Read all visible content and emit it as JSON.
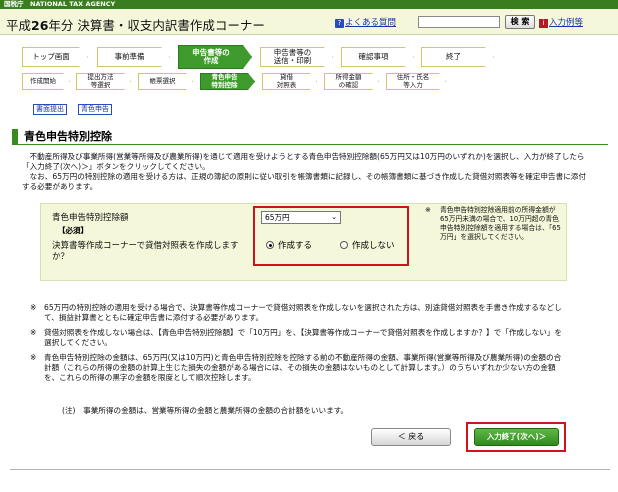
{
  "agency": "国税庁　NATIONAL TAX AGENCY",
  "header": {
    "title_prefix": "平成",
    "title_year": "26",
    "title_suffix": "年分 決算書・収支内訳書作成コーナー",
    "faq_icon": "?",
    "faq_link": "よくある質問",
    "search_placeholder": "",
    "search_button": "検 索",
    "help_icon": "i",
    "help_link": "入力例等"
  },
  "steps": [
    {
      "label": "トップ画面",
      "active": false
    },
    {
      "label": "事前準備",
      "active": false
    },
    {
      "label": "申告書等の\n作成",
      "active": true
    },
    {
      "label": "申告書等の\n送信・印刷",
      "active": false
    },
    {
      "label": "確認事項",
      "active": false
    },
    {
      "label": "終了",
      "active": false
    }
  ],
  "substeps": [
    {
      "label": "作成開始",
      "active": false
    },
    {
      "label": "提出方法\n等選択",
      "active": false
    },
    {
      "label": "帳票選択",
      "active": false
    },
    {
      "label": "青色申告\n特別控除",
      "active": true
    },
    {
      "label": "貸借\n対照表",
      "active": false
    },
    {
      "label": "所得金額\nの確認",
      "active": false
    },
    {
      "label": "住所・氏名\n等入力",
      "active": false
    }
  ],
  "tabs": {
    "first": "書面提出",
    "second": "青色申告"
  },
  "section_title": "青色申告特別控除",
  "intro": {
    "p1": "　不動産所得及び事業所得(営業等所得及び農業所得)を通じて適用を受けようとする青色申告特別控除額(65万円又は10万円のいずれか)を選択し、入力が終了したら「入力終了(次へ)＞」ボタンをクリックしてください。",
    "p2": "　なお、65万円の特別控除の適用を受ける方は、正規の簿記の原則に従い取引を帳簿書類に記録し、その帳簿書類に基づき作成した貸借対照表等を確定申告書に添付する必要があります。"
  },
  "form": {
    "deduction_label": "青色申告特別控除額",
    "required": "【必須】",
    "deduction_value": "65万円",
    "bs_question": "決算書等作成コーナーで貸借対照表を作成しますか？",
    "radio_yes": "作成する",
    "radio_no": "作成しない",
    "radio_selected": "yes",
    "note_mark": "※",
    "note": "青色申告特別控除適用前の所得金額が65万円未満の場合で、10万円超の青色申告特別控除額を適用する場合は、「65万円」を選択してください。"
  },
  "footnotes": [
    {
      "mark": "※",
      "text": "65万円の特別控除の適用を受ける場合で、決算書等作成コーナーで貸借対照表を作成しないを選択された方は、別途貸借対照表を手書き作成するなどして、損益計算書とともに確定申告書に添付する必要があります。"
    },
    {
      "mark": "※",
      "text": "貸借対照表を作成しない場合は、【青色申告特別控除額】で「10万円」を、【決算書等作成コーナーで貸借対照表を作成しますか？】で「作成しない」を選択してください。"
    },
    {
      "mark": "※",
      "text": "青色申告特別控除の金額は、65万円(又は10万円)と青色申告特別控除を控除する前の不動産所得の金額、事業所得(営業等所得及び農業所得)の金額の合計額（これらの所得の金額の計算上生じた損失の金額がある場合には、その損失の金額はないものとして計算します。）のうちいずれか少ない方の金額を、これらの所得の黒字の金額を限度として順次控除します。"
    }
  ],
  "footnote_sub": "(注)　事業所得の金額は、営業等所得の金額と農業所得の金額の合計額をいいます。",
  "buttons": {
    "back": "＜ 戻る",
    "next": "入力終了(次へ)＞"
  }
}
